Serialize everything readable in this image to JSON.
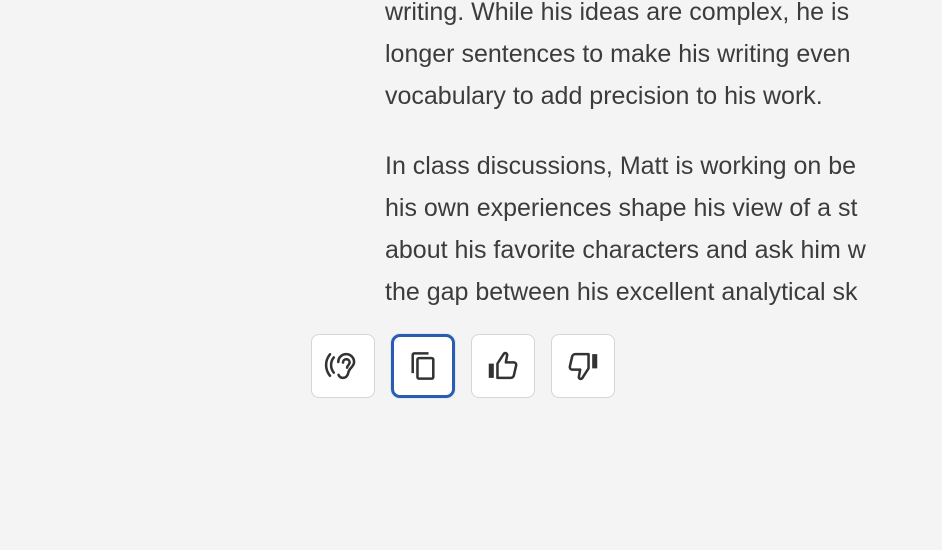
{
  "message": {
    "paragraphs": [
      {
        "lines": [
          "writing. While his ideas are complex, he is",
          "longer sentences to make his writing even",
          "vocabulary to add precision to his work."
        ]
      },
      {
        "lines": [
          "In class discussions, Matt is working on be",
          "his own experiences shape his view of a st",
          "about his favorite characters and ask him w",
          "the gap between his excellent analytical sk"
        ]
      }
    ]
  },
  "actions": [
    {
      "name": "read-aloud-button",
      "icon": "ear-icon",
      "focused": false
    },
    {
      "name": "copy-button",
      "icon": "copy-icon",
      "focused": true
    },
    {
      "name": "thumbs-up-button",
      "icon": "thumbs-up-icon",
      "focused": false
    },
    {
      "name": "thumbs-down-button",
      "icon": "thumbs-down-icon",
      "focused": false
    }
  ],
  "colors": {
    "background": "#f4f4f4",
    "text": "#3c3c3c",
    "focus_ring": "#2a5db0",
    "button_border": "#d6d6d6"
  }
}
